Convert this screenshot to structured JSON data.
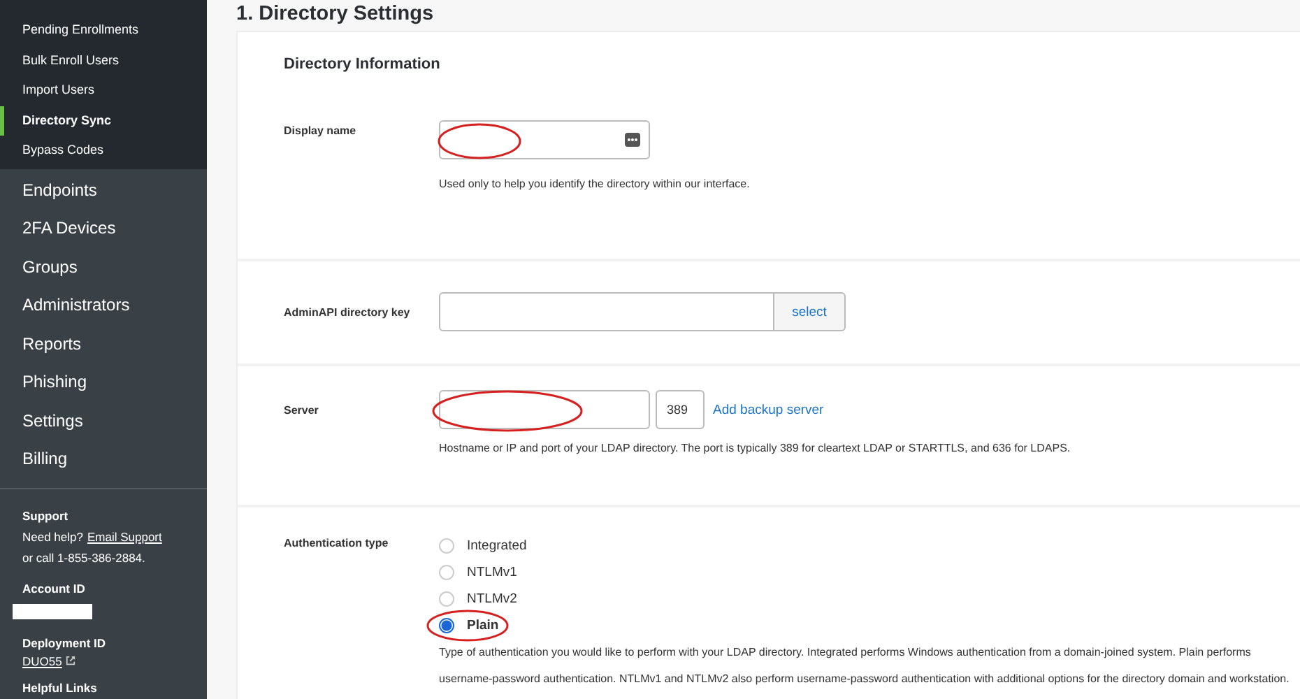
{
  "sidebar": {
    "sub_items": [
      {
        "label": "Pending Enrollments",
        "selected": false
      },
      {
        "label": "Bulk Enroll Users",
        "selected": false
      },
      {
        "label": "Import Users",
        "selected": false
      },
      {
        "label": "Directory Sync",
        "selected": true
      },
      {
        "label": "Bypass Codes",
        "selected": false
      }
    ],
    "items": [
      "Endpoints",
      "2FA Devices",
      "Groups",
      "Administrators",
      "Reports",
      "Phishing",
      "Settings",
      "Billing"
    ],
    "support": {
      "title": "Support",
      "help_text": "Need help?",
      "link": "Email Support",
      "call_text": "or call 1-855-386-2884."
    },
    "account": {
      "title": "Account ID"
    },
    "deployment": {
      "title": "Deployment ID",
      "link": "DUO55"
    },
    "helpful_links": {
      "title": "Helpful Links"
    }
  },
  "page_title": "1. Directory Settings",
  "section_title": "Directory Information",
  "display_name": {
    "label": "Display name",
    "circled": true,
    "hint": "Used only to help you identify the directory within our interface."
  },
  "admin_key": {
    "label": "AdminAPI directory key",
    "button": "select"
  },
  "server": {
    "label": "Server",
    "circled": true,
    "port": "389",
    "link": "Add backup server",
    "hint": "Hostname or IP and port of your LDAP directory. The port is typically 389 for cleartext LDAP or STARTTLS, and 636 for LDAPS."
  },
  "auth": {
    "label": "Authentication type",
    "options": [
      {
        "label": "Integrated",
        "selected": false,
        "circled": false
      },
      {
        "label": "NTLMv1",
        "selected": false,
        "circled": false
      },
      {
        "label": "NTLMv2",
        "selected": false,
        "circled": false
      },
      {
        "label": "Plain",
        "selected": true,
        "circled": true
      }
    ],
    "hint": "Type of authentication you would like to perform with your LDAP directory. Integrated performs Windows authentication from a domain-joined system. Plain performs username-password authentication. NTLMv1 and NTLMv2 also perform username-password authentication with additional options for the directory domain and workstation."
  }
}
